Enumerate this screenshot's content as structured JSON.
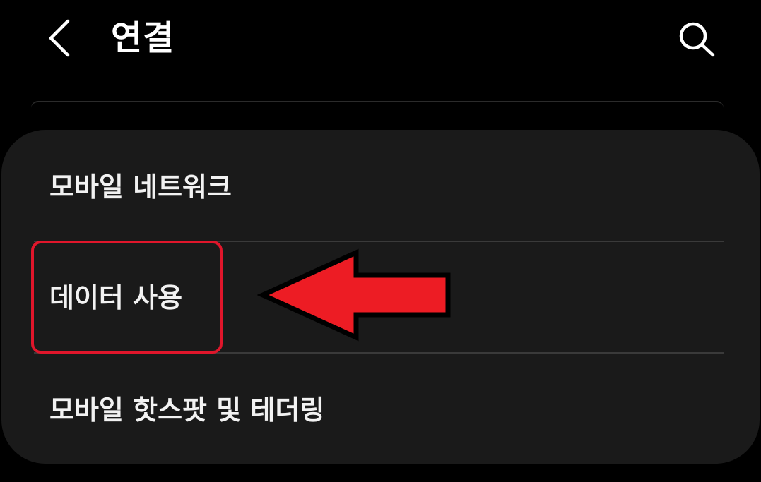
{
  "header": {
    "title": "연결",
    "back_icon": "chevron-left-icon",
    "search_icon": "search-icon"
  },
  "menu": {
    "items": [
      {
        "label": "모바일 네트워크"
      },
      {
        "label": "데이터 사용"
      },
      {
        "label": "모바일 핫스팟 및 테더링"
      }
    ]
  },
  "annotation": {
    "highlight_color": "#e0162b",
    "arrow_color": "#ed1c24",
    "arrow_icon": "arrow-left-icon"
  }
}
